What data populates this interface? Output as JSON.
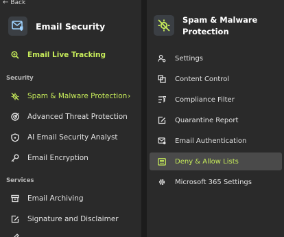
{
  "left": {
    "back_label": "Back",
    "app_title": "Email Security",
    "live_tracking": "Email Live Tracking",
    "sections": {
      "security": "Security",
      "services": "Services"
    },
    "security_items": [
      {
        "label": "Spam & Malware Protection",
        "icon": "virus-slash-icon"
      },
      {
        "label": "Advanced Threat Protection",
        "icon": "target-icon"
      },
      {
        "label": "AI Email Security Analyst",
        "icon": "shield-icon"
      },
      {
        "label": "Email Encryption",
        "icon": "key-icon"
      }
    ],
    "service_items": [
      {
        "label": "Email Archiving",
        "icon": "archive-icon"
      },
      {
        "label": "Signature and Disclaimer",
        "icon": "signature-icon"
      }
    ]
  },
  "right": {
    "title": "Spam & Malware Protection",
    "title_line1": "Spam & Malware",
    "title_line2": "Protection",
    "items": [
      {
        "label": "Settings",
        "icon": "user-gear-icon"
      },
      {
        "label": "Content Control",
        "icon": "content-icon"
      },
      {
        "label": "Compliance Filter",
        "icon": "filter-icon"
      },
      {
        "label": "Quarantine Report",
        "icon": "report-icon"
      },
      {
        "label": "Email Authentication",
        "icon": "email-check-icon"
      },
      {
        "label": "Deny & Allow Lists",
        "icon": "list-icon"
      },
      {
        "label": "Microsoft 365 Settings",
        "icon": "gear-icon"
      }
    ]
  },
  "colors": {
    "accent": "#c7ec5a",
    "panel_bg": "#2a2a2a",
    "active_bg": "#4a4a4a"
  }
}
